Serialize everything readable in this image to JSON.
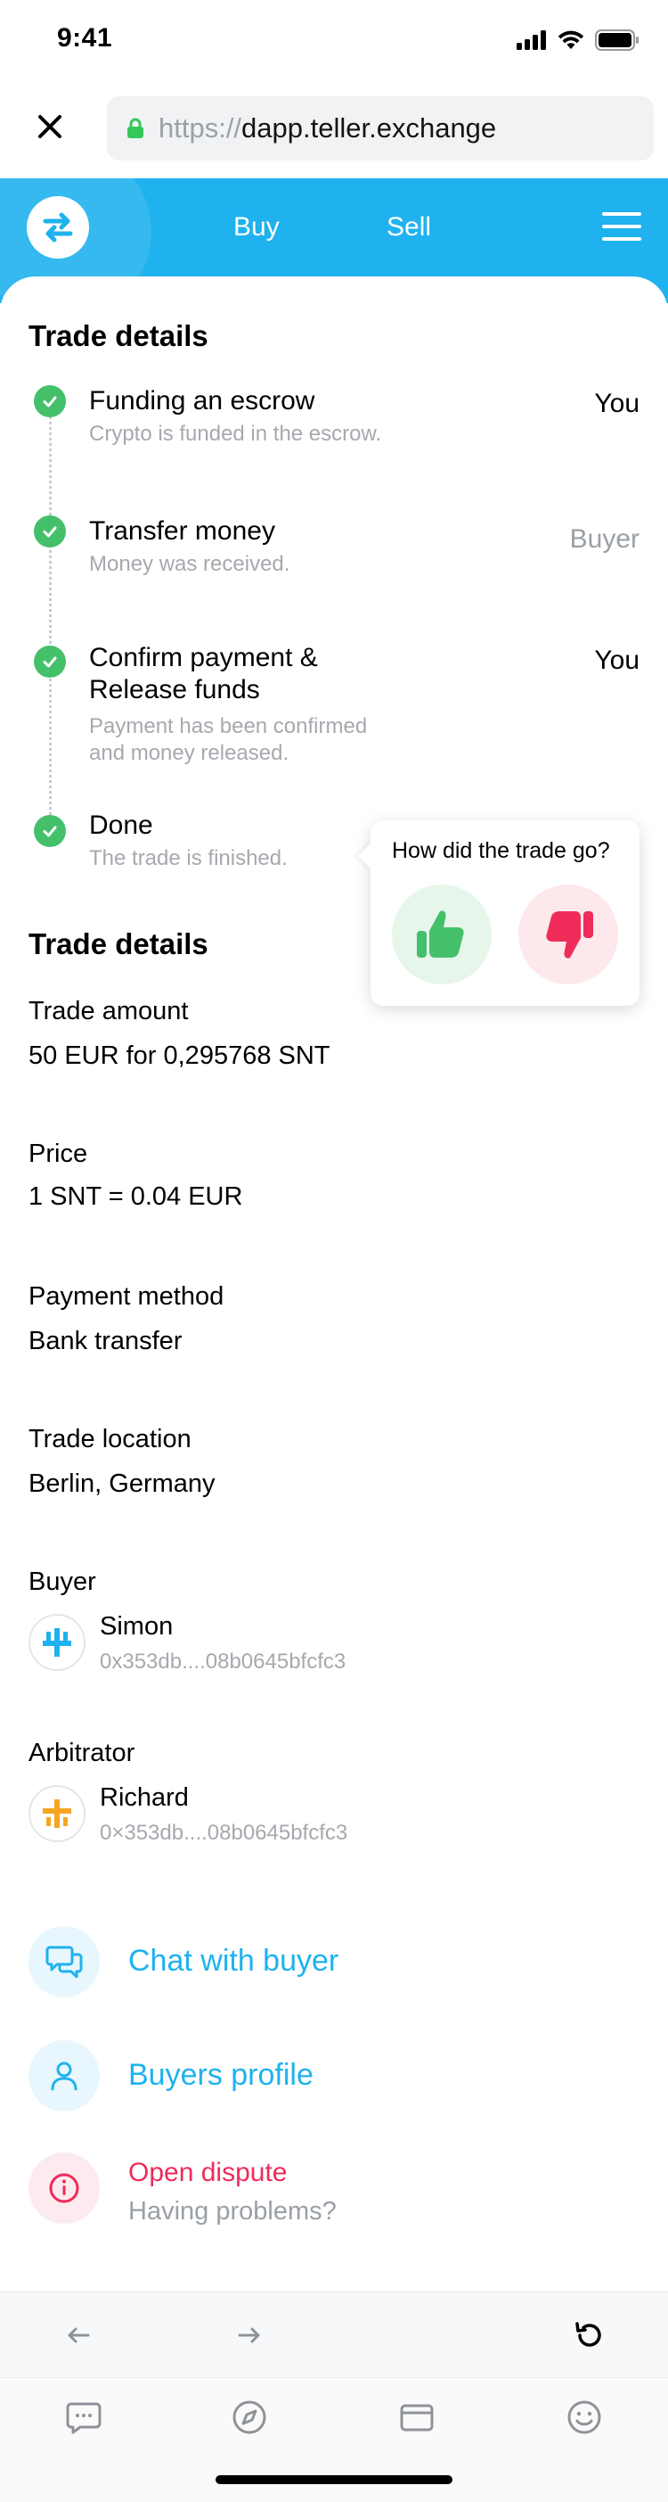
{
  "status_bar": {
    "time": "9:41"
  },
  "browser": {
    "url_prefix": "https://",
    "url_host": "dapp.teller.exchange"
  },
  "header": {
    "nav_buy": "Buy",
    "nav_sell": "Sell"
  },
  "progress": {
    "title": "Trade details",
    "steps": [
      {
        "title": "Funding an escrow",
        "desc": "Crypto is funded in the escrow.",
        "who": "You",
        "done": true
      },
      {
        "title": "Transfer money",
        "desc": "Money was received.",
        "who": "Buyer",
        "done": true
      },
      {
        "title_line1": "Confirm payment &",
        "title_line2": "Release funds",
        "desc_line1": "Payment has been confirmed",
        "desc_line2": "and money released.",
        "who": "You",
        "done": true
      },
      {
        "title": "Done",
        "desc": "The trade is finished.",
        "done": true
      }
    ]
  },
  "feedback": {
    "question": "How did the trade go?",
    "positive_icon": "thumbs-up-icon",
    "negative_icon": "thumbs-down-icon"
  },
  "details": {
    "title": "Trade details",
    "amount_label": "Trade amount",
    "amount_value": "50 EUR for 0,295768 SNT",
    "price_label": "Price",
    "price_value": "1 SNT = 0.04 EUR",
    "payment_label": "Payment method",
    "payment_value": "Bank transfer",
    "location_label": "Trade location",
    "location_value": "Berlin, Germany",
    "buyer_label": "Buyer",
    "buyer_name": "Simon",
    "buyer_address": "0x353db....08b0645bfcfc3",
    "arbitrator_label": "Arbitrator",
    "arbitrator_name": "Richard",
    "arbitrator_address": "0×353db....08b0645bfcfc3"
  },
  "actions": {
    "chat": "Chat with buyer",
    "profile": "Buyers profile",
    "dispute": "Open dispute",
    "dispute_sub": "Having problems?"
  },
  "colors": {
    "brand": "#1fb2ee",
    "success": "#44c06a",
    "danger": "#ef2b5a",
    "buyer_avatar": "#1fb2ee",
    "arbitrator_avatar": "#f5a623"
  }
}
